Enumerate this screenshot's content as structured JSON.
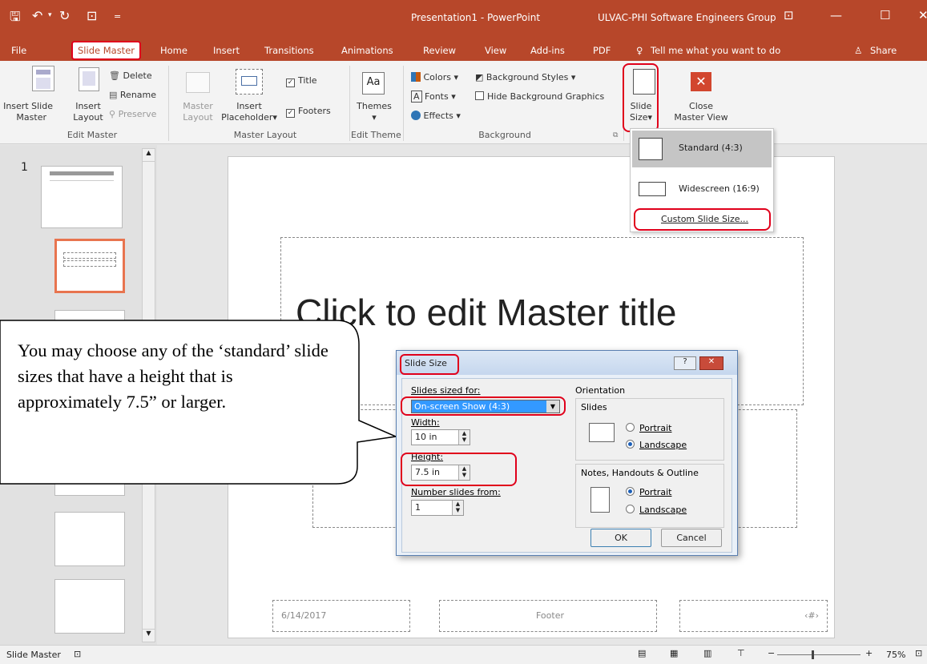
{
  "window": {
    "title": "Presentation1 - PowerPoint",
    "account": "ULVAC-PHI Software Engineers Group"
  },
  "tabs": [
    "File",
    "Slide Master",
    "Home",
    "Insert",
    "Transitions",
    "Animations",
    "Review",
    "View",
    "Add-ins",
    "PDF"
  ],
  "tell_me": "Tell me what you want to do",
  "share": "Share",
  "ribbon": {
    "edit_master": {
      "insert_slide_master": [
        "Insert Slide",
        "Master"
      ],
      "insert_layout": [
        "Insert",
        "Layout"
      ],
      "delete": "Delete",
      "rename": "Rename",
      "preserve": "Preserve",
      "group": "Edit Master"
    },
    "master_layout": {
      "master_layout": [
        "Master",
        "Layout"
      ],
      "insert_placeholder": [
        "Insert",
        "Placeholder"
      ],
      "title": "Title",
      "footers": "Footers",
      "group": "Master Layout"
    },
    "edit_theme": {
      "themes": "Themes",
      "group": "Edit Theme"
    },
    "background": {
      "colors": "Colors",
      "background_styles": "Background Styles",
      "fonts": "Fonts",
      "hide_bg": "Hide Background Graphics",
      "effects": "Effects",
      "group": "Background"
    },
    "size": {
      "slide_size": [
        "Slide",
        "Size"
      ],
      "close": [
        "Close",
        "Master View"
      ]
    }
  },
  "slide_size_menu": {
    "standard": "Standard (4:3)",
    "widescreen": "Widescreen (16:9)",
    "custom": "Custom Slide Size..."
  },
  "thumbs": {
    "number": "1"
  },
  "slide": {
    "title": "Click to edit Master title",
    "date": "6/14/2017",
    "footer": "Footer",
    "number": "‹#›"
  },
  "callout": "You may choose any of the ‘standard’ slide sizes that have a height that is approximately 7.5” or larger.",
  "dialog": {
    "title": "Slide Size",
    "sized_for_label": "Slides sized for:",
    "sized_for_value": "On-screen Show (4:3)",
    "width_label": "Width:",
    "width_value": "10 in",
    "height_label": "Height:",
    "height_value": "7.5 in",
    "number_label": "Number slides from:",
    "number_value": "1",
    "orientation": "Orientation",
    "slides": "Slides",
    "portrait": "Portrait",
    "landscape": "Landscape",
    "notes": "Notes, Handouts & Outline",
    "notes_portrait": "Portrait",
    "notes_landscape": "Landscape",
    "ok": "OK",
    "cancel": "Cancel",
    "help": "?"
  },
  "status": {
    "mode": "Slide Master",
    "zoom": "75%"
  },
  "colors": {
    "accent": "#b7472a",
    "highlight": "#e0001b"
  }
}
